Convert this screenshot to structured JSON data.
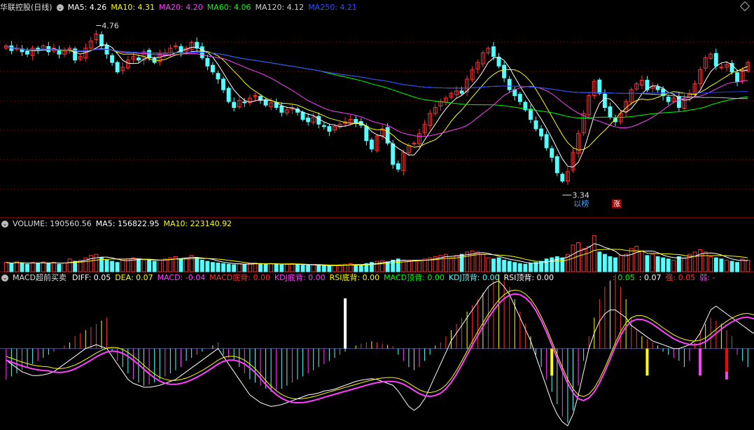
{
  "colors": {
    "up": "#ff3232",
    "down": "#54ffff",
    "ma5": "#ffffff",
    "ma10": "#ffff00",
    "ma20": "#ff40ff",
    "ma60": "#00ff00",
    "ma120": "#c0c0c0",
    "ma250": "#2040ff",
    "grid": "#800000"
  },
  "price_header": {
    "title": "华联控股(日线)",
    "ma5": "MA5: 4.26",
    "ma10": "MA10: 4.31",
    "ma20": "MA20: 4.20",
    "ma60": "MA60: 4.06",
    "ma120": "MA120: 4.12",
    "ma250": "MA250: 4.21"
  },
  "volume_header": {
    "volume": "VOLUME: 190560.56",
    "ma5": "MA5: 156822.95",
    "ma10": "MA10: 223140.92"
  },
  "macd_header": {
    "name": "MACD超前买卖",
    "diff": "DIFF: 0.05",
    "dea": "DEA: 0.07",
    "macd": "MACD: -0.04",
    "macd_bottom": "MACD底背: 0.00",
    "kdj_bottom": "KDJ底背: 0.00",
    "rsi_bottom": "RSI底背: 0.00",
    "macd_top": "MACD顶背: 0.00",
    "kdj_top": "KDJ顶背: 0.00",
    "rsi_top": "RSI顶背: 0.00",
    "v1": ": 0.05",
    "v2": ": 0.07",
    "strong": "强: 0.05",
    "weak": "弱: -"
  },
  "annotations": {
    "high": "4.76",
    "low": "3.34",
    "tag1": "以榜",
    "tag2": "涨"
  },
  "chart_data": [
    {
      "type": "candlestick",
      "ylim": [
        3.2,
        4.9
      ],
      "grid": true,
      "close": [
        4.62,
        4.58,
        4.6,
        4.57,
        4.55,
        4.6,
        4.58,
        4.62,
        4.57,
        4.6,
        4.55,
        4.58,
        4.6,
        4.5,
        4.53,
        4.6,
        4.66,
        4.72,
        4.62,
        4.55,
        4.48,
        4.4,
        4.44,
        4.5,
        4.53,
        4.5,
        4.57,
        4.52,
        4.48,
        4.55,
        4.56,
        4.6,
        4.62,
        4.57,
        4.6,
        4.65,
        4.6,
        4.52,
        4.45,
        4.4,
        4.34,
        4.25,
        4.15,
        4.1,
        4.16,
        4.14,
        4.18,
        4.2,
        4.16,
        4.12,
        4.14,
        4.1,
        4.06,
        4.08,
        4.1,
        4.06,
        4.0,
        3.98,
        4.02,
        3.96,
        3.94,
        3.9,
        3.94,
        3.96,
        3.98,
        4.0,
        3.97,
        3.95,
        3.82,
        3.75,
        3.86,
        3.92,
        3.8,
        3.62,
        3.58,
        3.72,
        3.78,
        3.8,
        3.88,
        3.96,
        4.05,
        4.1,
        4.15,
        4.18,
        4.22,
        4.24,
        4.22,
        4.34,
        4.42,
        4.48,
        4.56,
        4.6,
        4.53,
        4.45,
        4.35,
        4.25,
        4.2,
        4.15,
        4.08,
        4.0,
        3.92,
        3.86,
        3.76,
        3.68,
        3.55,
        3.48,
        3.56,
        3.72,
        3.88,
        4.05,
        4.2,
        4.32,
        4.22,
        4.1,
        4.02,
        3.98,
        4.05,
        4.15,
        4.25,
        4.3,
        4.33,
        4.25,
        4.28,
        4.25,
        4.2,
        4.15,
        4.18,
        4.1,
        4.18,
        4.22,
        4.3,
        4.42,
        4.52,
        4.55,
        4.45,
        4.44,
        4.46,
        4.4,
        4.32,
        4.42,
        4.48
      ],
      "spread": 0.04
    },
    {
      "type": "bar",
      "ylim": [
        0,
        70
      ],
      "values": [
        16,
        14,
        17,
        15,
        13,
        16,
        15,
        17,
        14,
        16,
        13,
        15,
        22,
        18,
        20,
        24,
        28,
        30,
        24,
        20,
        18,
        16,
        20,
        22,
        24,
        22,
        20,
        20,
        18,
        20,
        22,
        24,
        26,
        22,
        24,
        28,
        24,
        20,
        18,
        16,
        15,
        14,
        13,
        12,
        14,
        13,
        14,
        15,
        14,
        13,
        14,
        13,
        12,
        13,
        14,
        12,
        11,
        11,
        12,
        11,
        10,
        10,
        11,
        12,
        13,
        14,
        12,
        11,
        14,
        16,
        18,
        19,
        17,
        20,
        22,
        20,
        18,
        19,
        20,
        22,
        24,
        26,
        28,
        30,
        24,
        28,
        30,
        34,
        36,
        34,
        30,
        24,
        22,
        24,
        20,
        18,
        16,
        14,
        13,
        14,
        16,
        18,
        22,
        24,
        26,
        24,
        30,
        46,
        50,
        40,
        44,
        62,
        34,
        30,
        26,
        24,
        28,
        30,
        40,
        44,
        36,
        28,
        30,
        26,
        24,
        22,
        20,
        26,
        24,
        30,
        34,
        38,
        34,
        26,
        24,
        22,
        20,
        18,
        16,
        22,
        20
      ]
    },
    {
      "type": "bar",
      "ylim": [
        -0.2,
        0.17
      ],
      "values": [
        -0.05,
        -0.045,
        -0.04,
        -0.035,
        -0.03,
        -0.025,
        -0.02,
        -0.015,
        -0.01,
        -0.005,
        0,
        0.005,
        0.01,
        0.02,
        0.025,
        0.03,
        0.035,
        0.04,
        0.045,
        0.05,
        -0.005,
        -0.02,
        -0.03,
        -0.04,
        -0.05,
        -0.055,
        -0.06,
        -0.058,
        -0.055,
        -0.05,
        -0.045,
        -0.04,
        -0.035,
        -0.03,
        -0.02,
        -0.015,
        -0.01,
        -0.005,
        0,
        0.005,
        0.01,
        -0.01,
        -0.015,
        -0.02,
        -0.03,
        -0.04,
        -0.05,
        -0.055,
        -0.06,
        -0.065,
        -0.07,
        -0.068,
        -0.065,
        -0.06,
        -0.055,
        -0.05,
        -0.045,
        -0.04,
        -0.035,
        -0.03,
        -0.025,
        -0.02,
        -0.015,
        -0.01,
        -0.005,
        0,
        0.005,
        0.008,
        0.01,
        0.012,
        0.01,
        0.008,
        0.006,
        0.004,
        -0.01,
        -0.02,
        -0.03,
        -0.035,
        -0.03,
        -0.02,
        -0.01,
        0.005,
        0.01,
        0.02,
        0.03,
        0.04,
        0.05,
        0.06,
        0.07,
        0.08,
        0.09,
        0.1,
        0.11,
        0.12,
        0.11,
        0.1,
        0.08,
        0.06,
        0.04,
        0.02,
        -0.01,
        -0.03,
        -0.05,
        -0.07,
        -0.09,
        -0.11,
        -0.12,
        -0.1,
        -0.06,
        -0.02,
        0.02,
        0.05,
        0.08,
        0.1,
        0.11,
        0.12,
        0.1,
        0.08,
        0.05,
        0.03,
        0.02,
        0.015,
        0.01,
        0.005,
        -0.005,
        -0.01,
        -0.015,
        -0.02,
        -0.03,
        -0.02,
        0.01,
        0.03,
        0.04,
        0.05,
        0.045,
        0.04,
        0.03,
        0.02,
        -0.01,
        -0.02,
        -0.03
      ],
      "diff": [
        -0.03,
        -0.04,
        -0.05,
        -0.06,
        -0.065,
        -0.07,
        -0.07,
        -0.068,
        -0.065,
        -0.06,
        -0.05,
        -0.04,
        -0.03,
        -0.02,
        -0.01,
        0,
        0.005,
        0.01,
        0.005,
        0,
        -0.02,
        -0.04,
        -0.06,
        -0.08,
        -0.09,
        -0.095,
        -0.1,
        -0.1,
        -0.098,
        -0.095,
        -0.09,
        -0.085,
        -0.08,
        -0.07,
        -0.06,
        -0.05,
        -0.04,
        -0.03,
        -0.02,
        -0.01,
        0,
        -0.02,
        -0.04,
        -0.06,
        -0.08,
        -0.1,
        -0.12,
        -0.13,
        -0.14,
        -0.145,
        -0.15,
        -0.148,
        -0.145,
        -0.14,
        -0.135,
        -0.13,
        -0.125,
        -0.12,
        -0.118,
        -0.115,
        -0.11,
        -0.108,
        -0.105,
        -0.1,
        -0.095,
        -0.09,
        -0.085,
        -0.082,
        -0.08,
        -0.078,
        -0.08,
        -0.085,
        -0.09,
        -0.095,
        -0.11,
        -0.13,
        -0.15,
        -0.16,
        -0.15,
        -0.13,
        -0.1,
        -0.07,
        -0.04,
        -0.01,
        0.02,
        0.04,
        0.06,
        0.08,
        0.1,
        0.12,
        0.14,
        0.16,
        0.17,
        0.175,
        0.16,
        0.14,
        0.11,
        0.08,
        0.05,
        0.02,
        -0.02,
        -0.06,
        -0.1,
        -0.14,
        -0.17,
        -0.19,
        -0.2,
        -0.17,
        -0.12,
        -0.06,
        0,
        0.04,
        0.07,
        0.09,
        0.1,
        0.1,
        0.09,
        0.08,
        0.06,
        0.05,
        0.04,
        0.03,
        0.02,
        0.015,
        0.01,
        0.005,
        0,
        0,
        0.005,
        0.01,
        0.02,
        0.04,
        0.07,
        0.1,
        0.11,
        0.1,
        0.09,
        0.08,
        0.07,
        0.06,
        0.05,
        0.04,
        0.045
      ]
    }
  ]
}
